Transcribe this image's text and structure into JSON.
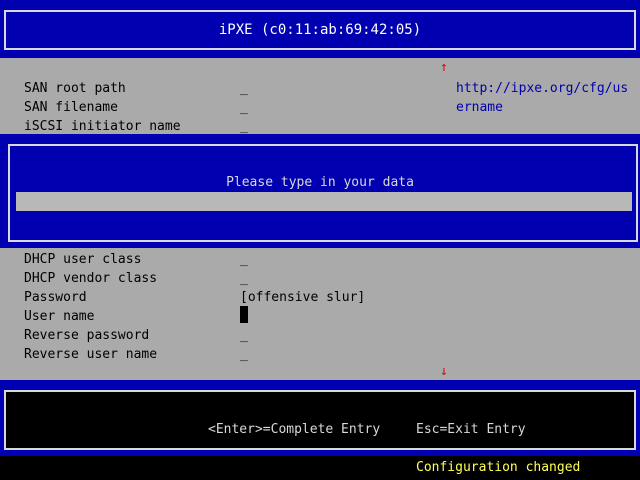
{
  "title": "iPXE (c0:11:ab:69:42:05)",
  "help": {
    "line1": "http://ipxe.org/cfg/us",
    "line2": "ername"
  },
  "arrows": {
    "up": "↑",
    "down": "↓"
  },
  "settings_top": [
    {
      "label": "SAN root path",
      "value": "_"
    },
    {
      "label": "SAN filename",
      "value": "_"
    },
    {
      "label": "iSCSI initiator name",
      "value": "_"
    }
  ],
  "settings_bottom": [
    {
      "label": "DHCP user class",
      "value": "_"
    },
    {
      "label": "DHCP vendor class",
      "value": "_"
    },
    {
      "label": "Password",
      "value": "[offensive slur]"
    },
    {
      "label": "User name",
      "value": ""
    },
    {
      "label": "Reverse password",
      "value": "_"
    },
    {
      "label": "Reverse user name",
      "value": "_"
    }
  ],
  "dialog": {
    "prompt": "Please type in your data",
    "input_value": ""
  },
  "keys": {
    "enter": "<Enter>=Complete Entry",
    "esc": "Esc=Exit Entry"
  },
  "status": "Configuration changed",
  "colors": {
    "frame_blue": "#0000b0",
    "panel_gray": "#aaaaaa",
    "status_yellow": "#ffff55",
    "arrow_red": "#e00000",
    "help_blue": "#0000aa"
  }
}
